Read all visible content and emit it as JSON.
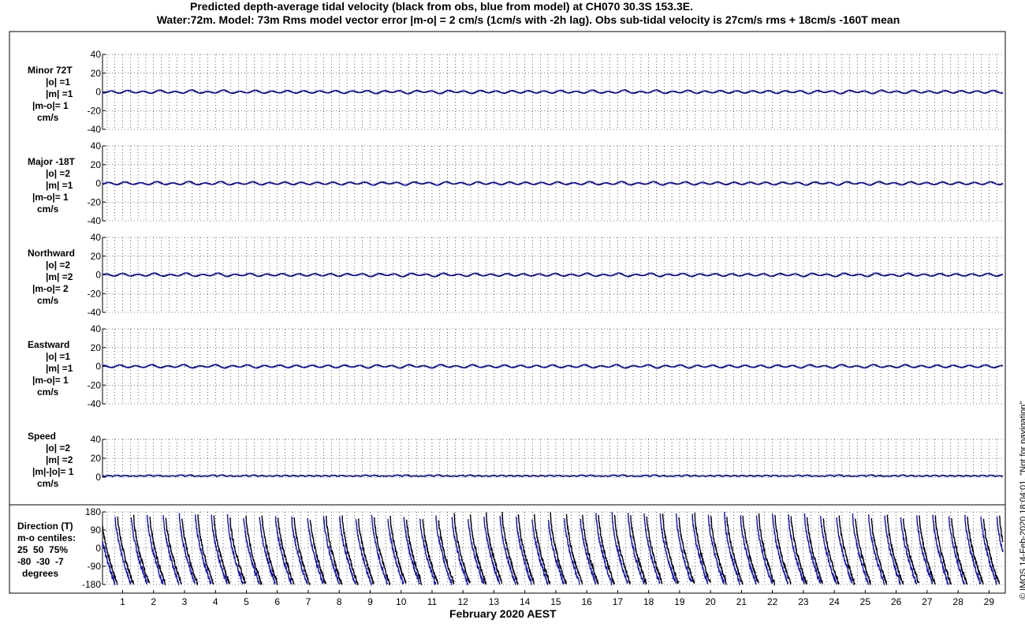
{
  "title_line1": "Predicted depth-average tidal velocity (black from obs, blue from model) at CH070 30.3S 153.3E.",
  "title_line2": "Water:72m. Model: 73m  Rms model vector error |m-o| = 2 cm/s (1cm/s with -2h lag). Obs sub-tidal velocity is 27cm/s rms + 18cm/s -160T mean",
  "xlabel": "February 2020 AEST",
  "credit": "© IMOS 14-Feb-2020 18:04:01. \"Not for navigation\"",
  "colors": {
    "obs": "#000000",
    "model": "#1010cc",
    "grid": "#000000"
  },
  "panels": [
    {
      "id": "minor",
      "label_lines": [
        "Minor 72T",
        "|o| =1",
        "|m| =1",
        "|m-o|= 1",
        "cm/s"
      ],
      "yticks": [
        "40",
        "20",
        "0",
        "-20",
        "-40"
      ],
      "ylim": [
        -40,
        40
      ],
      "type": "line"
    },
    {
      "id": "major",
      "label_lines": [
        "Major -18T",
        "|o| =2",
        "|m| =1",
        "|m-o|= 1",
        "cm/s"
      ],
      "yticks": [
        "40",
        "20",
        "0",
        "-20",
        "-40"
      ],
      "ylim": [
        -40,
        40
      ],
      "type": "line"
    },
    {
      "id": "north",
      "label_lines": [
        "Northward",
        "|o| =2",
        "|m| =2",
        "|m-o|= 2",
        "cm/s"
      ],
      "yticks": [
        "40",
        "20",
        "0",
        "-20",
        "-40"
      ],
      "ylim": [
        -40,
        40
      ],
      "type": "line"
    },
    {
      "id": "east",
      "label_lines": [
        "Eastward",
        "|o| =1",
        "|m| =1",
        "|m-o|= 1",
        "cm/s"
      ],
      "yticks": [
        "40",
        "20",
        "0",
        "-20",
        "-40"
      ],
      "ylim": [
        -40,
        40
      ],
      "type": "line"
    },
    {
      "id": "speed",
      "label_lines": [
        "Speed",
        "|o| =2",
        "|m| =2",
        "|m|-|o|= 1",
        "cm/s"
      ],
      "yticks": [
        "40",
        "20",
        "0"
      ],
      "ylim": [
        0,
        40
      ],
      "type": "line"
    },
    {
      "id": "direction",
      "label_lines": [
        "Direction (T)",
        "m-o centiles:",
        "25  50  75%",
        "-80  -30  -7",
        "degrees"
      ],
      "yticks": [
        "180",
        "90",
        "0",
        "-90",
        "-180"
      ],
      "ylim": [
        -180,
        180
      ],
      "type": "direction"
    }
  ],
  "chart_data": {
    "type": "line",
    "title": "Predicted depth-average tidal velocity (black from obs, blue from model) at CH070 30.3S 153.3E.",
    "xlabel": "February 2020 AEST",
    "x_tick_labels": [
      "1",
      "2",
      "3",
      "4",
      "5",
      "6",
      "7",
      "8",
      "9",
      "10",
      "11",
      "12",
      "13",
      "14",
      "15",
      "16",
      "17",
      "18",
      "19",
      "20",
      "21",
      "22",
      "23",
      "24",
      "25",
      "26",
      "27",
      "28",
      "29"
    ],
    "xlim_days": [
      0.35,
      29.45
    ],
    "series": [
      {
        "name": "black from obs",
        "color": "#000000"
      },
      {
        "name": "blue from model",
        "color": "#1010cc"
      }
    ],
    "panels": [
      {
        "label": "Minor 72T",
        "units": "cm/s",
        "ylim": [
          -40,
          40
        ],
        "obs_amplitude": 1,
        "model_amplitude": 1
      },
      {
        "label": "Major -18T",
        "units": "cm/s",
        "ylim": [
          -40,
          40
        ],
        "obs_amplitude": 2,
        "model_amplitude": 1
      },
      {
        "label": "Northward",
        "units": "cm/s",
        "ylim": [
          -40,
          40
        ],
        "obs_amplitude": 2,
        "model_amplitude": 2
      },
      {
        "label": "Eastward",
        "units": "cm/s",
        "ylim": [
          -40,
          40
        ],
        "obs_amplitude": 1,
        "model_amplitude": 1
      },
      {
        "label": "Speed",
        "units": "cm/s",
        "ylim": [
          0,
          40
        ],
        "obs_amplitude": 2,
        "model_amplitude": 2
      },
      {
        "label": "Direction (T)",
        "units": "degrees",
        "ylim": [
          -180,
          180
        ],
        "m_minus_o_centiles": {
          "25": -80,
          "50": -30,
          "75": -7
        }
      }
    ]
  }
}
